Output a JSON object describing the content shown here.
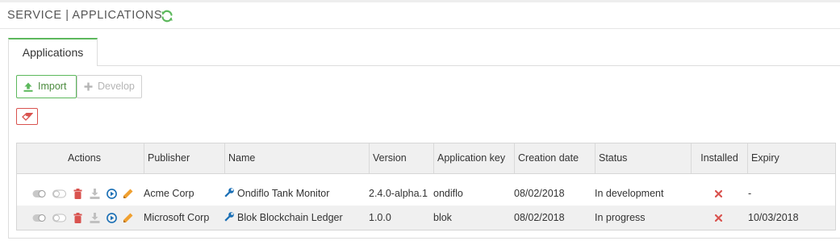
{
  "header": {
    "title": "SERVICE | APPLICATIONS",
    "refresh_icon": "refresh-icon"
  },
  "tabs": [
    {
      "label": "Applications",
      "active": true
    }
  ],
  "toolbar": {
    "import_label": "Import",
    "develop_label": "Develop",
    "erase_icon": "eraser-icon"
  },
  "table": {
    "columns": [
      "Actions",
      "Publisher",
      "Name",
      "Version",
      "Application key",
      "Creation date",
      "Status",
      "Installed",
      "Expiry"
    ],
    "rows": [
      {
        "publisher": "Acme Corp",
        "name": "Ondiflo Tank Monitor",
        "version": "2.4.0-alpha.1",
        "key": "ondiflo",
        "created": "08/02/2018",
        "status": "In development",
        "installed": false,
        "expiry": "-"
      },
      {
        "publisher": "Microsoft Corp",
        "name": "Blok Blockchain Ledger",
        "version": "1.0.0",
        "key": "blok",
        "created": "08/02/2018",
        "status": "In progress",
        "installed": false,
        "expiry": "10/03/2018"
      }
    ]
  },
  "colors": {
    "accent_green": "#5cb85c",
    "danger_red": "#d9534f",
    "icon_blue": "#1a6fb5",
    "edit_orange": "#f0a030",
    "header_bg": "#f0f0f0"
  }
}
